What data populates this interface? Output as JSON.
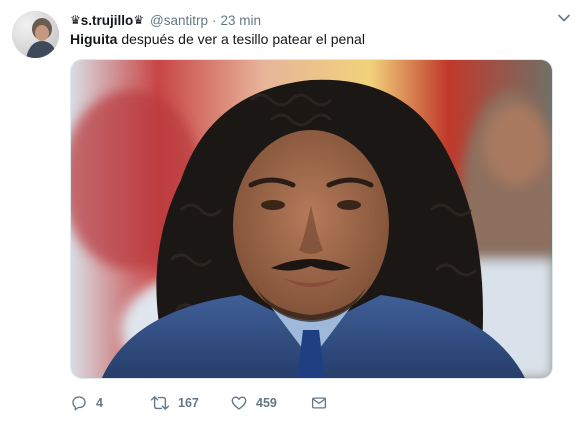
{
  "tweet": {
    "display_name": "s.trujillo",
    "name_prefix_icon": "crown-icon",
    "name_suffix_icon": "crown-icon",
    "handle": "@santitrp",
    "separator": "·",
    "time": "23 min",
    "text_bold": "Higuita",
    "text_rest": " después de ver a tesillo patear el penal",
    "media_icon": "photo-of-man-with-curly-hair"
  },
  "actions": {
    "reply_count": "4",
    "retweet_count": "167",
    "like_count": "459"
  },
  "colors": {
    "secondary_text": "#657786",
    "primary_text": "#14171a",
    "border": "#e1e8ed"
  }
}
